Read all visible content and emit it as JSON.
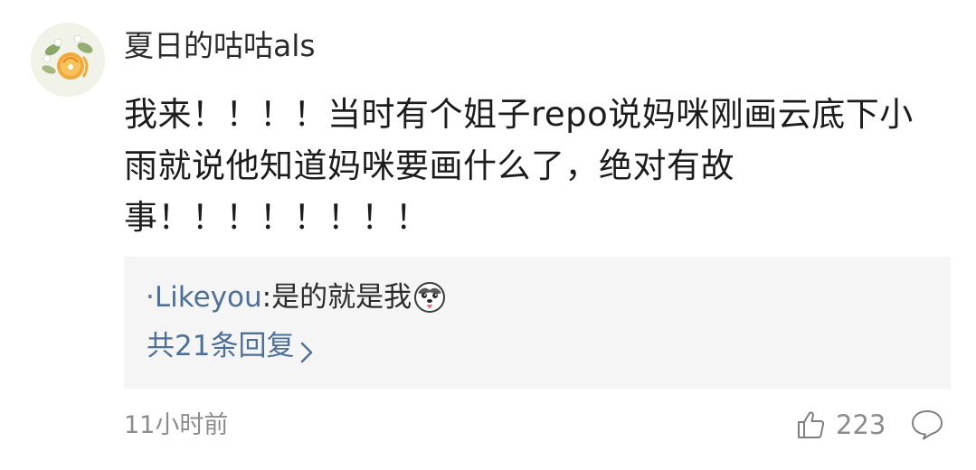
{
  "comment": {
    "username": "夏日的咕咕als",
    "text": "我来！！！！当时有个姐子repo说妈咪刚画云底下小雨就说他知道妈咪要画什么了，绝对有故事！！！！！！！！",
    "reply": {
      "author": "·Likeyou",
      "colon": ":",
      "text": "是的就是我",
      "more_label": "共21条回复"
    },
    "timestamp": "11小时前",
    "likes": "223"
  },
  "icons": {
    "avatar": "orange-flower-avatar",
    "emoji": "husky-tongue-emoji",
    "chevron": "chevron-right-icon",
    "like": "thumbs-up-icon",
    "comment": "speech-bubble-icon"
  },
  "colors": {
    "link": "#4f7096",
    "text": "#1c1c1c",
    "muted": "#8c8c8c",
    "reply_bg": "#f5f5f5"
  }
}
